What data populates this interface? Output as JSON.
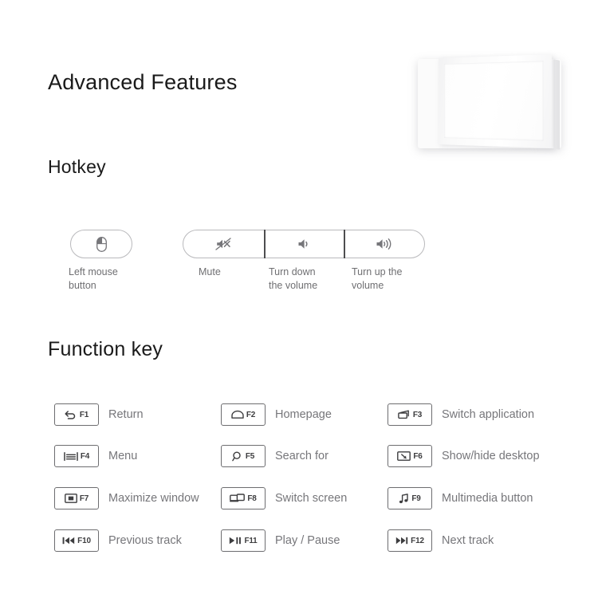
{
  "page": {
    "title": "Advanced Features",
    "sections": {
      "hotkey_heading": "Hotkey",
      "function_key_heading": "Function key"
    },
    "colors": {
      "heading": "#1a1a1a",
      "label": "#76767a",
      "key_border": "#6d6d70",
      "pill_border": "#b9b9bc",
      "divider": "#4d4d4f",
      "background": "#ffffff"
    }
  },
  "product_image": {
    "name": "white-tablet-device",
    "description": "White rectangular device shown at an angle"
  },
  "hotkeys": [
    {
      "icon": "mouse-left-button-icon",
      "label": "Left mouse\nbutton",
      "label_line1": "Left mouse",
      "label_line2": "button"
    },
    {
      "icon": "volume-mute-icon",
      "label_line1": "Mute",
      "label_line2": ""
    },
    {
      "icon": "volume-down-icon",
      "label_line1": "Turn down",
      "label_line2": "the volume"
    },
    {
      "icon": "volume-up-icon",
      "label_line1": "Turn up the",
      "label_line2": "volume"
    }
  ],
  "function_keys": [
    {
      "fn": "F1",
      "icon": "return-arrow-icon",
      "label": "Return"
    },
    {
      "fn": "F2",
      "icon": "home-icon",
      "label": "Homepage"
    },
    {
      "fn": "F3",
      "icon": "switch-application-icon",
      "label": "Switch application"
    },
    {
      "fn": "F4",
      "icon": "menu-icon",
      "label": "Menu"
    },
    {
      "fn": "F5",
      "icon": "search-icon",
      "label": "Search for"
    },
    {
      "fn": "F6",
      "icon": "show-hide-desktop-icon",
      "label": "Show/hide desktop"
    },
    {
      "fn": "F7",
      "icon": "maximize-window-icon",
      "label": "Maximize window"
    },
    {
      "fn": "F8",
      "icon": "switch-screen-icon",
      "label": "Switch screen"
    },
    {
      "fn": "F9",
      "icon": "music-note-icon",
      "label": "Multimedia button"
    },
    {
      "fn": "F10",
      "icon": "previous-track-icon",
      "label": "Previous track"
    },
    {
      "fn": "F11",
      "icon": "play-pause-icon",
      "label": "Play / Pause"
    },
    {
      "fn": "F12",
      "icon": "next-track-icon",
      "label": "Next track"
    }
  ]
}
